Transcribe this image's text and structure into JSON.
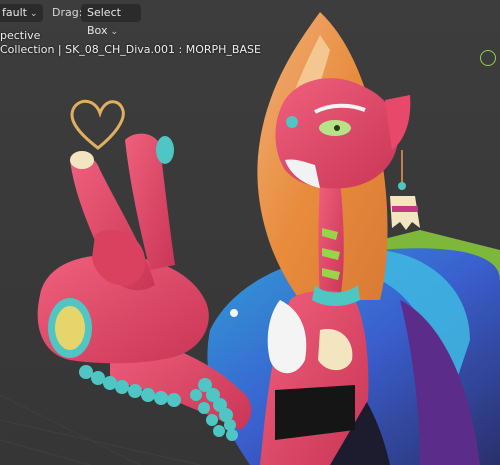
{
  "header": {
    "shading_dropdown": "fault",
    "drag_label": "Drag:",
    "drag_dropdown": "Select Box"
  },
  "overlay": {
    "view_mode": "pective",
    "object_path": "Collection | SK_08_CH_Diva.001 : MORPH_BASE"
  },
  "colors": {
    "viewport_bg": "#3a3a3a",
    "skin": "#e8496b",
    "hood": "#e89a4a",
    "accent_teal": "#4fc6c4",
    "gizmo": "#8fd14f"
  },
  "icons": [
    "chevron-down-icon",
    "heart-icon",
    "gizmo-icon"
  ]
}
